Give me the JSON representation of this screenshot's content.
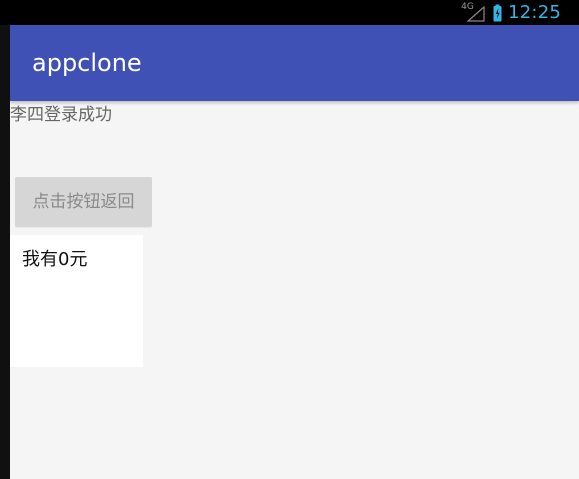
{
  "status_bar": {
    "signal_label": "4G",
    "time": "12:25",
    "signal_icon": "signal-icon",
    "battery_icon": "battery-charging-icon"
  },
  "app_bar": {
    "title": "appclone"
  },
  "content": {
    "login_message": "李四登录成功",
    "back_button_label": "点击按钮返回",
    "money_text": "我有0元"
  },
  "colors": {
    "status_bar": "#000000",
    "time_text": "#33b5e5",
    "app_bar": "#3f51b5",
    "screen_background": "#f5f5f5",
    "button_background": "#d6d6d6",
    "money_panel_background": "#ffffff"
  }
}
